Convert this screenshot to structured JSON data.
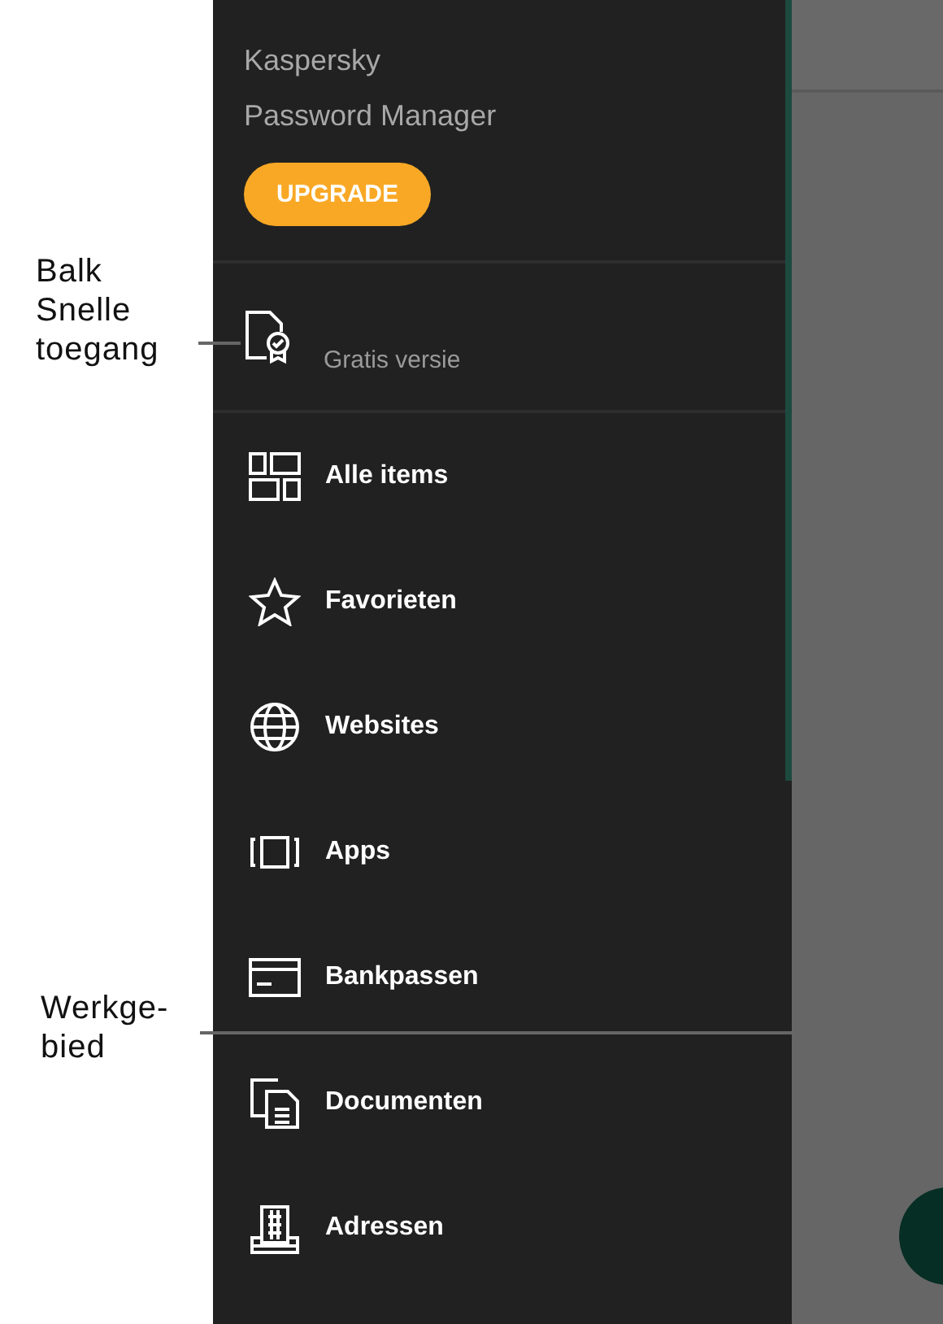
{
  "callouts": [
    {
      "label": "Balk Snelle toegang"
    },
    {
      "label": "Werkge-bied"
    }
  ],
  "drawer": {
    "title_lines": [
      "Kaspersky",
      "Password Manager"
    ],
    "upgrade_button": "UPGRADE",
    "quick_access": {
      "subtitle": "Gratis versie"
    },
    "menu_items": [
      {
        "label": "Alle items"
      },
      {
        "label": "Favorieten"
      },
      {
        "label": "Websites"
      },
      {
        "label": "Apps"
      },
      {
        "label": "Bankpassen"
      },
      {
        "label": "Documenten"
      },
      {
        "label": "Adressen"
      }
    ]
  }
}
